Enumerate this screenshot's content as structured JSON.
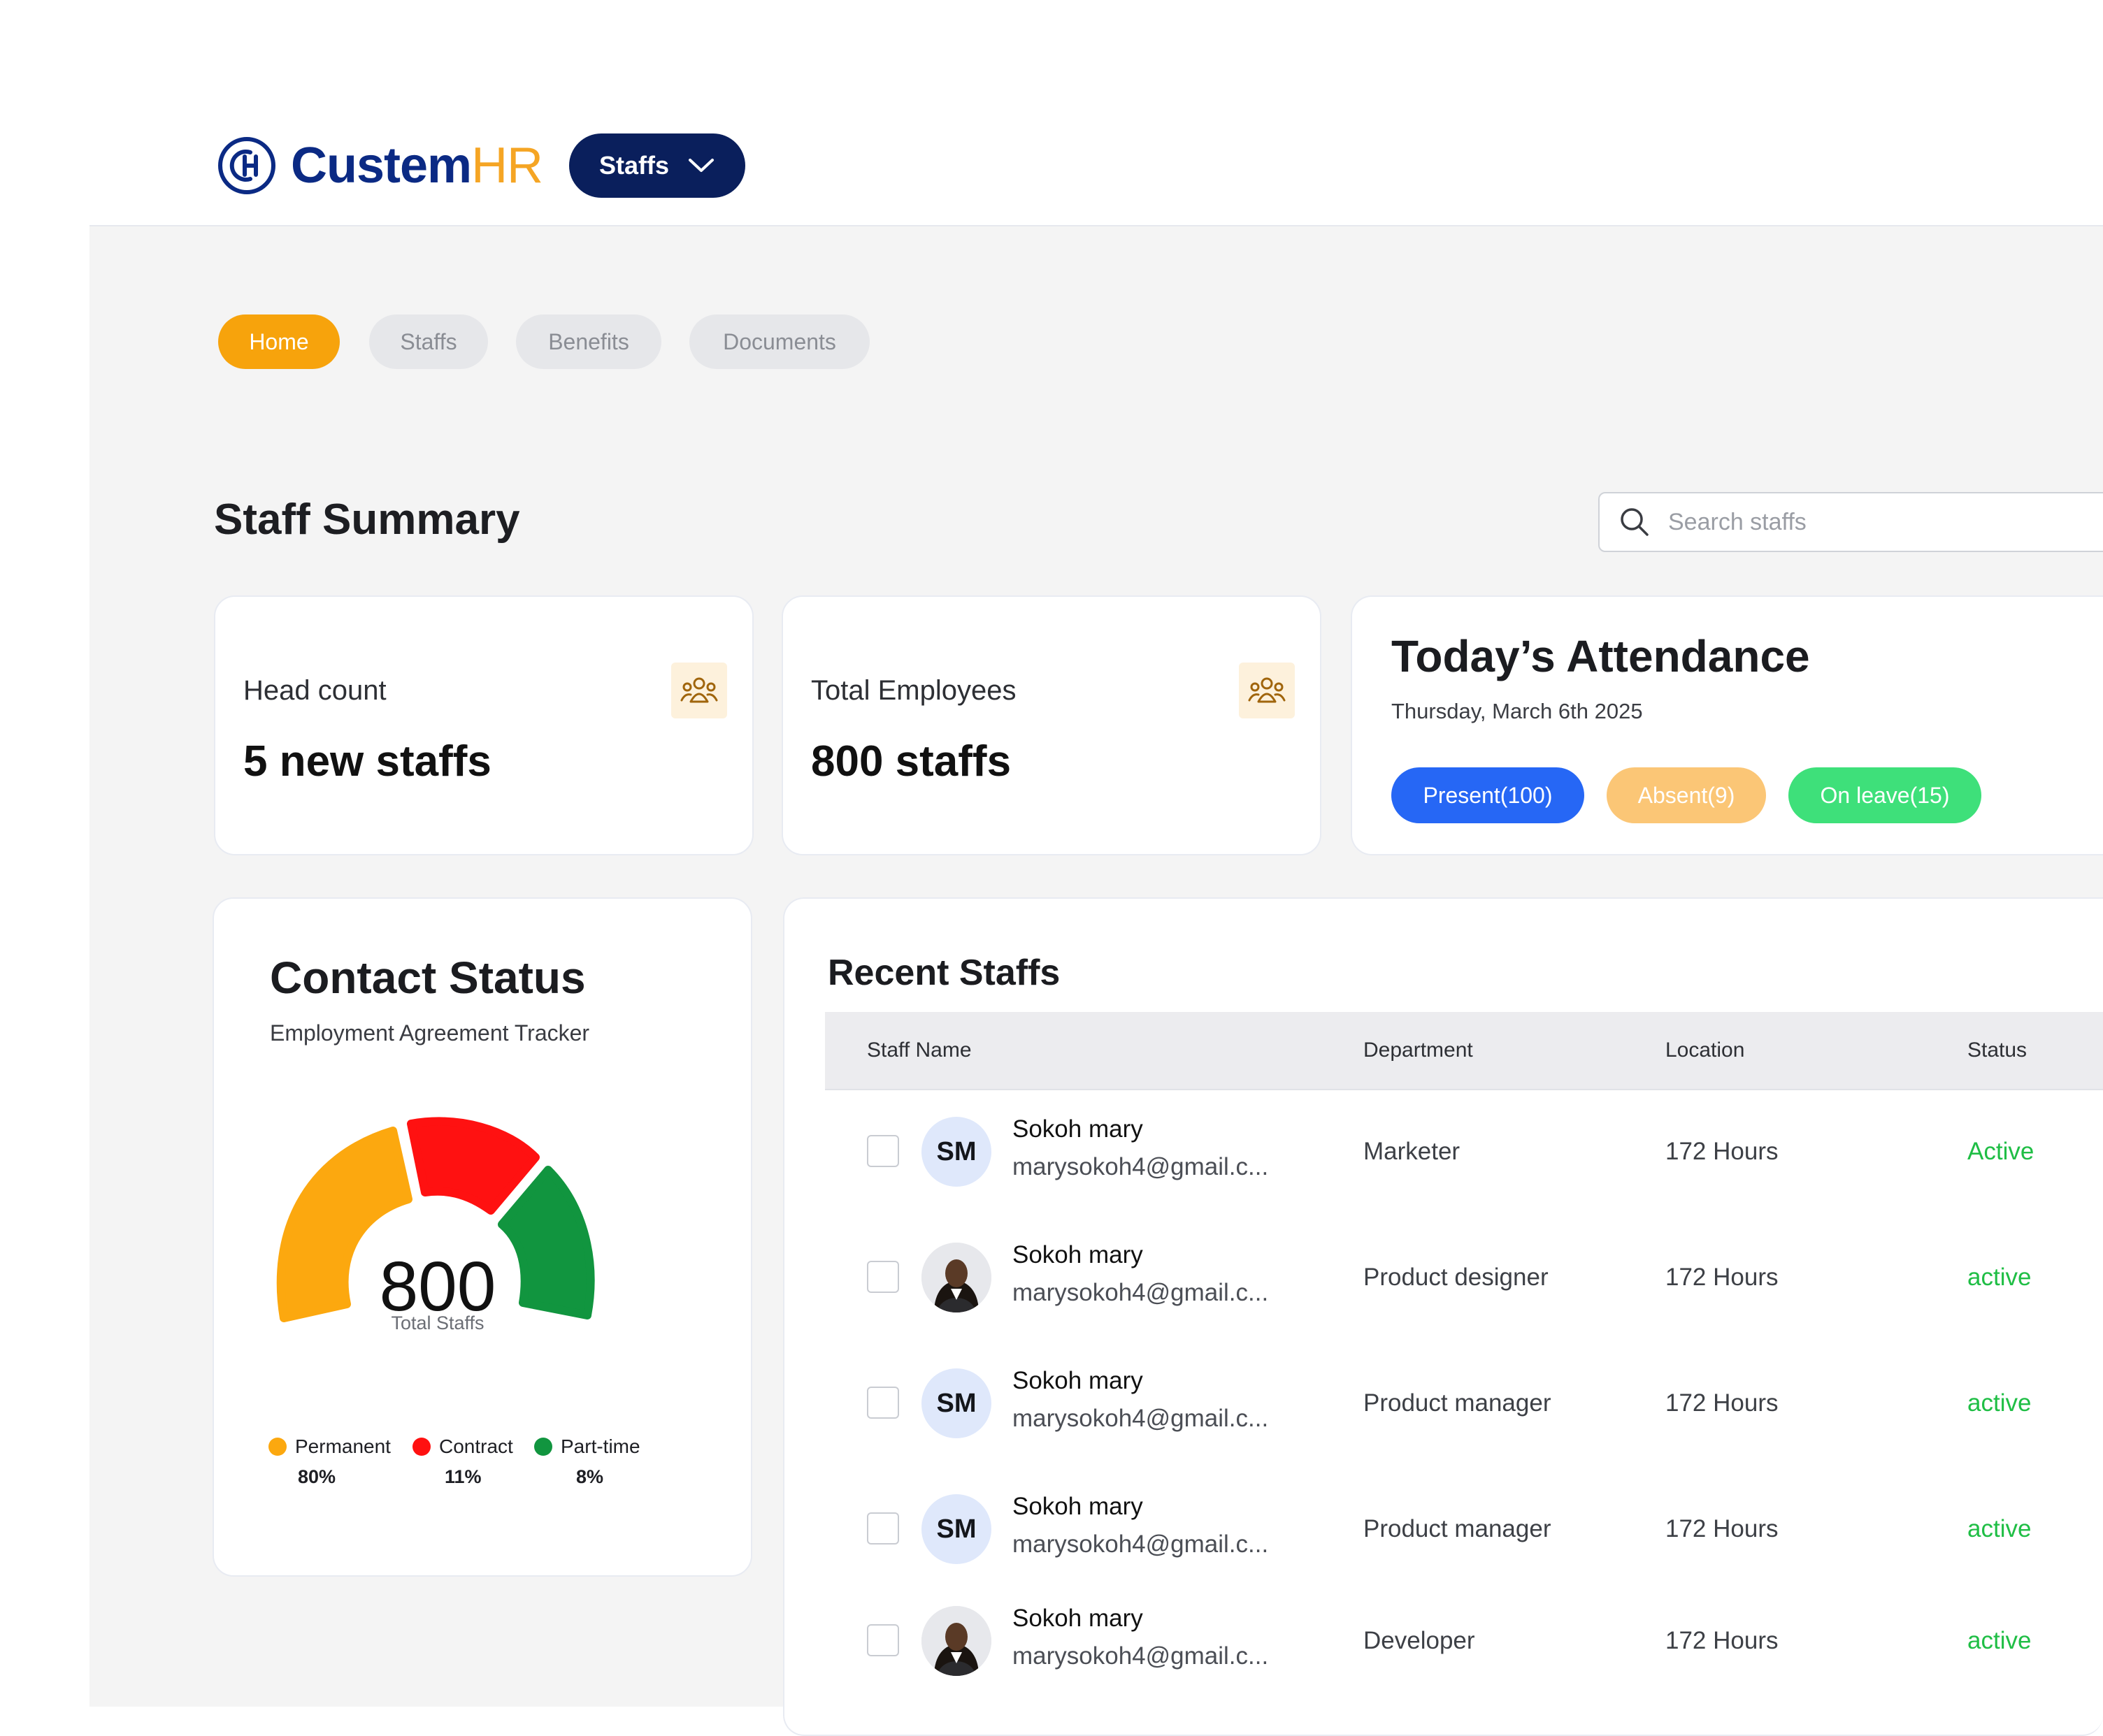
{
  "brand": {
    "name_primary": "Custem",
    "name_accent": "HR",
    "logo_icon": "ch-circle-logo"
  },
  "header": {
    "dropdown_label": "Staffs",
    "dropdown_icon": "chevron-down-icon"
  },
  "nav": {
    "tabs": [
      {
        "label": "Home",
        "active": true
      },
      {
        "label": "Staffs",
        "active": false
      },
      {
        "label": "Benefits",
        "active": false
      },
      {
        "label": "Documents",
        "active": false
      }
    ]
  },
  "summary": {
    "title": "Staff Summary",
    "search": {
      "placeholder": "Search staffs",
      "value": "",
      "icon": "search-icon"
    },
    "head_count": {
      "label": "Head count",
      "value": "5 new staffs",
      "icon": "users-icon"
    },
    "total_employees": {
      "label": "Total Employees",
      "value": "800 staffs",
      "icon": "users-icon"
    },
    "attendance": {
      "title": "Today’s Attendance",
      "date": "Thursday, March 6th 2025",
      "present": "Present(100)",
      "absent": "Absent(9)",
      "on_leave": "On leave(15)",
      "colors": {
        "present": "#2667f5",
        "absent": "#fbc676",
        "on_leave": "#3ee07a"
      }
    }
  },
  "contact_status": {
    "title": "Contact Status",
    "subtitle": "Employment Agreement Tracker",
    "total_value": "800",
    "total_label": "Total Staffs",
    "segments": [
      {
        "label": "Permanent",
        "pct": "80%",
        "color": "#fca80f"
      },
      {
        "label": "Contract",
        "pct": "11%",
        "color": "#ff1111"
      },
      {
        "label": "Part-time",
        "pct": "8%",
        "color": "#11953f"
      }
    ]
  },
  "recent_staffs": {
    "title": "Recent Staffs",
    "columns": {
      "name": "Staff Name",
      "department": "Department",
      "location": "Location",
      "status": "Status"
    },
    "rows": [
      {
        "initials": "SM",
        "photo": false,
        "name": "Sokoh mary",
        "email": "marysokoh4@gmail.c...",
        "department": "Marketer",
        "location": "172 Hours",
        "status": "Active"
      },
      {
        "initials": "",
        "photo": true,
        "name": "Sokoh mary",
        "email": "marysokoh4@gmail.c...",
        "department": "Product designer",
        "location": "172 Hours",
        "status": "active"
      },
      {
        "initials": "SM",
        "photo": false,
        "name": "Sokoh mary",
        "email": "marysokoh4@gmail.c...",
        "department": "Product manager",
        "location": "172 Hours",
        "status": "active"
      },
      {
        "initials": "SM",
        "photo": false,
        "name": "Sokoh mary",
        "email": "marysokoh4@gmail.c...",
        "department": "Product manager",
        "location": "172 Hours",
        "status": "active"
      },
      {
        "initials": "",
        "photo": true,
        "name": "Sokoh mary",
        "email": "marysokoh4@gmail.c...",
        "department": "Developer",
        "location": "172 Hours",
        "status": "active"
      }
    ]
  }
}
